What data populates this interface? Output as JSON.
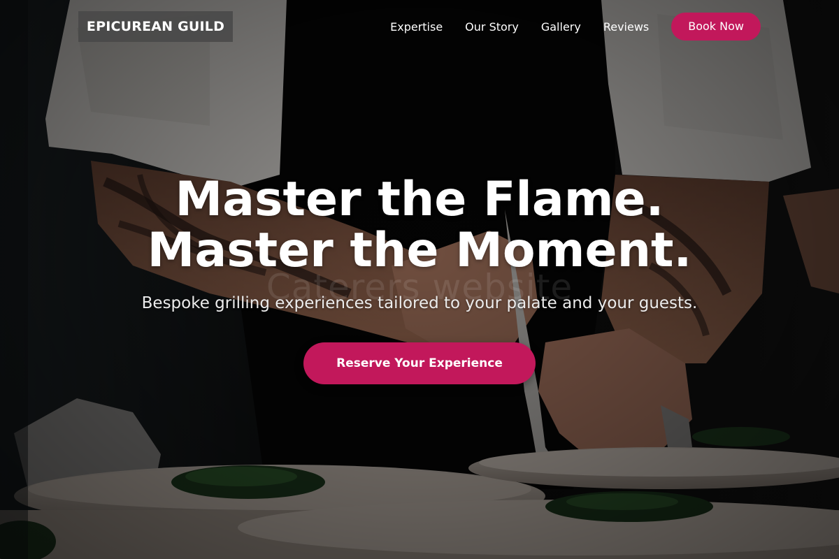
{
  "brand": {
    "logo_text": "EPICUREAN GUILD"
  },
  "nav": {
    "links": [
      {
        "label": "Expertise"
      },
      {
        "label": "Our Story"
      },
      {
        "label": "Gallery"
      },
      {
        "label": "Reviews"
      }
    ],
    "book_label": "Book Now"
  },
  "hero": {
    "headline_line1": "Master the Flame.",
    "headline_line2": "Master the Moment.",
    "watermark": "Caterers website",
    "subtitle": "Bespoke grilling experiences tailored to your palate and your guests.",
    "cta_label": "Reserve Your Experience"
  },
  "colors": {
    "accent": "#c2185b",
    "logo_bg": "#484848",
    "text": "#ffffff"
  }
}
